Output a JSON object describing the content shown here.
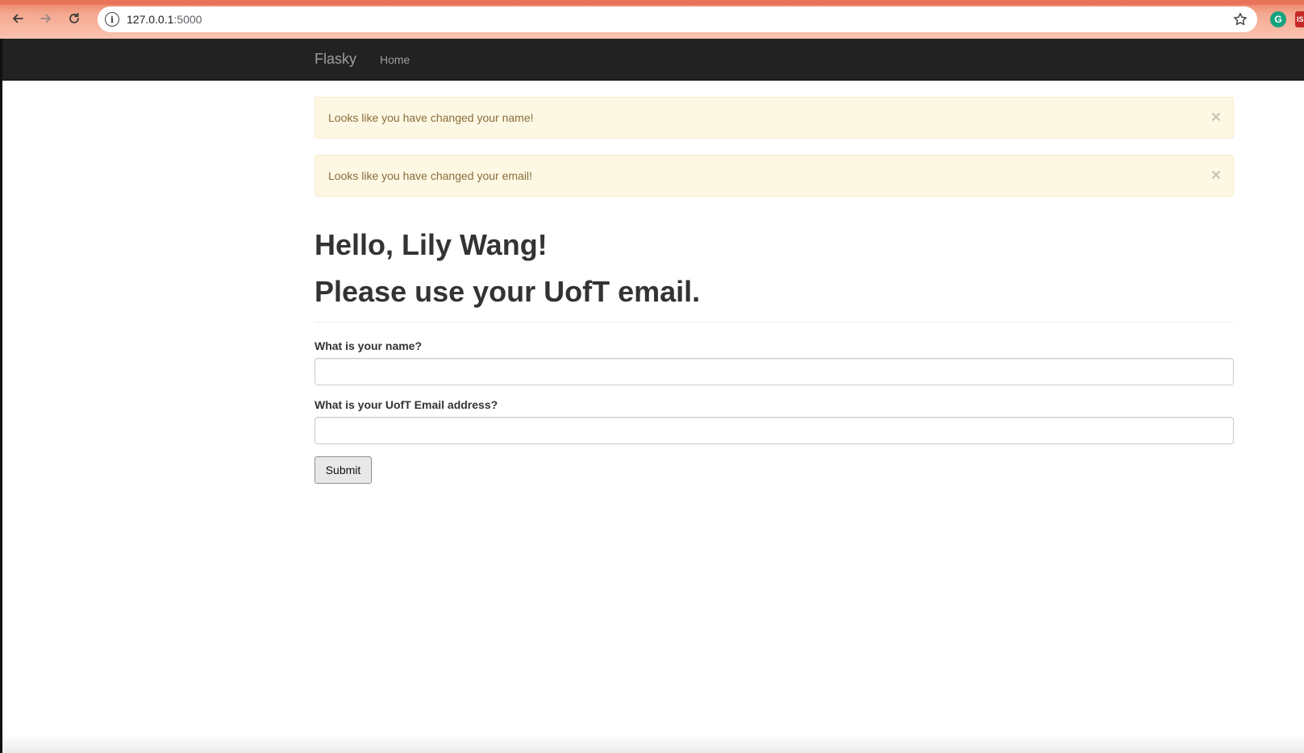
{
  "browser": {
    "url_host": "127.0.0.1",
    "url_port": ":5000",
    "extension_g_label": "G",
    "extension_red_label": "IS"
  },
  "navbar": {
    "brand": "Flasky",
    "links": [
      {
        "label": "Home"
      }
    ]
  },
  "alerts": [
    {
      "message": "Looks like you have changed your name!",
      "close": "×"
    },
    {
      "message": "Looks like you have changed your email!",
      "close": "×"
    }
  ],
  "header": {
    "greeting": "Hello, Lily Wang!",
    "notice": "Please use your UofT email."
  },
  "form": {
    "name_label": "What is your name?",
    "name_value": "",
    "email_label": "What is your UofT Email address?",
    "email_value": "",
    "submit_label": "Submit"
  },
  "colors": {
    "navbar_bg": "#222222",
    "alert_bg": "#fcf8e3",
    "alert_text": "#8a6d3b",
    "chrome_accent": "#e97c5e"
  }
}
